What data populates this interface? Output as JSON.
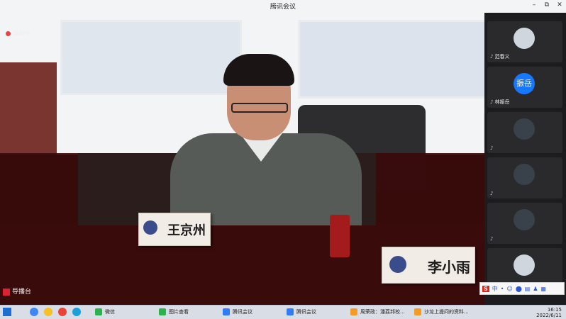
{
  "window": {
    "title": "腾讯会议",
    "minimize": "–",
    "maximize": "⧉",
    "close": "✕"
  },
  "recording": {
    "label": "录制中"
  },
  "nameplates": [
    {
      "name": "王京州"
    },
    {
      "name": "李小雨"
    }
  ],
  "participants": [
    {
      "name": "范春义",
      "avatar": "",
      "avatar_style": "light"
    },
    {
      "name": "林振岳",
      "avatar": "振岳",
      "avatar_style": "blue"
    },
    {
      "name": "",
      "avatar": "",
      "avatar_style": "dark"
    },
    {
      "name": "",
      "avatar": "",
      "avatar_style": "dark"
    },
    {
      "name": "",
      "avatar": "",
      "avatar_style": "dark"
    },
    {
      "name": "",
      "avatar": "",
      "avatar_style": "light"
    }
  ],
  "active_speaker": {
    "label": "导播台"
  },
  "ime": {
    "s": "S",
    "mode": "中",
    "items": [
      "•",
      "☺",
      "⬤",
      "▤",
      "♟",
      "▦"
    ]
  },
  "taskbar": {
    "apps": [
      {
        "label": "微信",
        "color": "#2bb24c"
      },
      {
        "label": "图片查看",
        "color": "#2bb24c"
      },
      {
        "label": "腾讯会议",
        "color": "#2f7cf6"
      },
      {
        "label": "腾讯会议",
        "color": "#2f7cf6"
      },
      {
        "label": "周荣政：潘荔邦校...",
        "color": "#f59b23"
      },
      {
        "label": "沙龙上提问的资料...",
        "color": "#f59b23"
      }
    ],
    "time": "16:15",
    "date": "2022/6/11"
  },
  "colors": {
    "accent": "#1677ff",
    "recording": "#e04848"
  }
}
